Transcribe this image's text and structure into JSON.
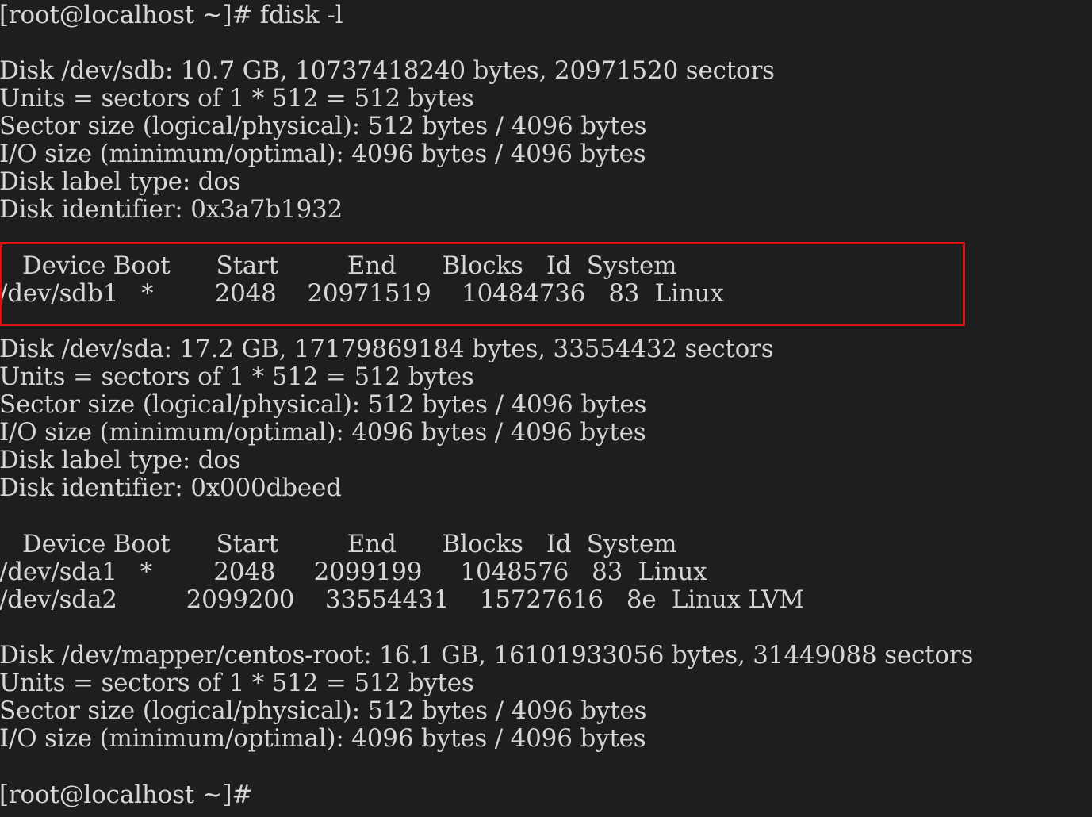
{
  "terminal": {
    "prompt_command": "[root@localhost ~]# fdisk -l",
    "sdb": {
      "disk": "Disk /dev/sdb: 10.7 GB, 10737418240 bytes, 20971520 sectors",
      "units": "Units = sectors of 1 * 512 = 512 bytes",
      "sector_size": "Sector size (logical/physical): 512 bytes / 4096 bytes",
      "io_size": "I/O size (minimum/optimal): 4096 bytes / 4096 bytes",
      "label_type": "Disk label type: dos",
      "identifier": "Disk identifier: 0x3a7b1932",
      "table_header": "   Device Boot      Start         End      Blocks   Id  System",
      "partitions": [
        "/dev/sdb1   *        2048    20971519    10484736   83  Linux"
      ]
    },
    "sda": {
      "disk": "Disk /dev/sda: 17.2 GB, 17179869184 bytes, 33554432 sectors",
      "units": "Units = sectors of 1 * 512 = 512 bytes",
      "sector_size": "Sector size (logical/physical): 512 bytes / 4096 bytes",
      "io_size": "I/O size (minimum/optimal): 4096 bytes / 4096 bytes",
      "label_type": "Disk label type: dos",
      "identifier": "Disk identifier: 0x000dbeed",
      "table_header": "   Device Boot      Start         End      Blocks   Id  System",
      "partitions": [
        "/dev/sda1   *        2048     2099199     1048576   83  Linux",
        "/dev/sda2         2099200    33554431    15727616   8e  Linux LVM"
      ]
    },
    "centos_root": {
      "disk": "Disk /dev/mapper/centos-root: 16.1 GB, 16101933056 bytes, 31449088 sectors",
      "units": "Units = sectors of 1 * 512 = 512 bytes",
      "sector_size": "Sector size (logical/physical): 512 bytes / 4096 bytes",
      "io_size": "I/O size (minimum/optimal): 4096 bytes / 4096 bytes"
    },
    "prompt_final": "[root@localhost ~]#"
  },
  "colors": {
    "background": "#1e1e1e",
    "text": "#d6d6d6",
    "highlight_border": "#e01010"
  }
}
